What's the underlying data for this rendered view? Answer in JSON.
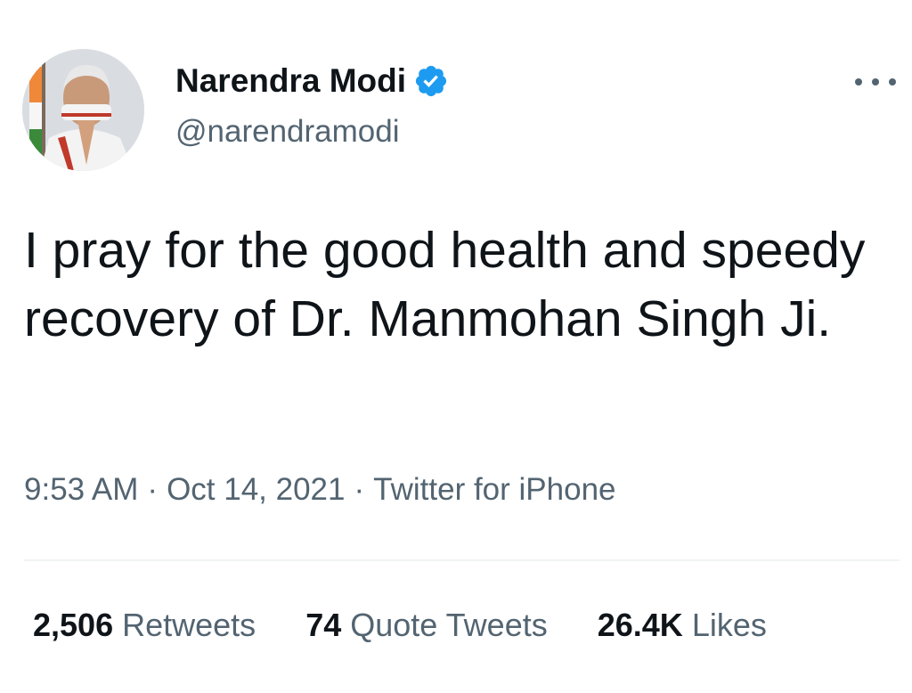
{
  "tweet": {
    "author": {
      "display_name": "Narendra Modi",
      "handle": "@narendramodi",
      "verified": true,
      "avatar_icon": "profile-photo"
    },
    "more_icon": "more-options-icon",
    "text": "I pray for the good health and speedy recovery of Dr. Manmohan Singh Ji.",
    "time": "9:53 AM",
    "separator": "·",
    "date": "Oct 14, 2021",
    "source": "Twitter for iPhone",
    "stats": {
      "retweets": {
        "count": "2,506",
        "label": "Retweets"
      },
      "quotes": {
        "count": "74",
        "label": "Quote Tweets"
      },
      "likes": {
        "count": "26.4K",
        "label": "Likes"
      }
    }
  },
  "colors": {
    "primary_text": "#0f1419",
    "secondary_text": "#536471",
    "verified_blue": "#1d9bf0",
    "divider": "#eff3f4"
  }
}
